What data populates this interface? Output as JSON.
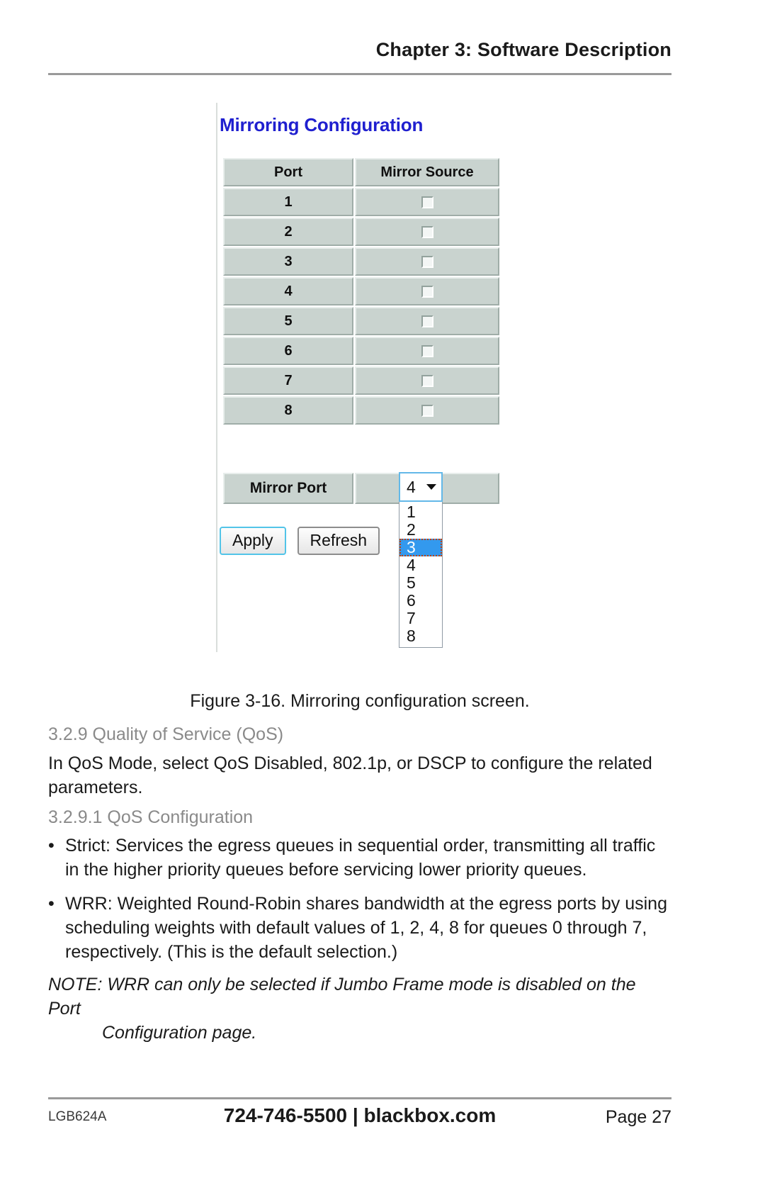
{
  "header": {
    "chapter_title": "Chapter 3: Software Description"
  },
  "figure": {
    "screen_title": "Mirroring Configuration",
    "title_color": "#1f1fcf",
    "table": {
      "columns": [
        "Port",
        "Mirror Source"
      ],
      "rows": [
        {
          "port": "1",
          "mirror_source_checked": false
        },
        {
          "port": "2",
          "mirror_source_checked": false
        },
        {
          "port": "3",
          "mirror_source_checked": false
        },
        {
          "port": "4",
          "mirror_source_checked": false
        },
        {
          "port": "5",
          "mirror_source_checked": false
        },
        {
          "port": "6",
          "mirror_source_checked": false
        },
        {
          "port": "7",
          "mirror_source_checked": false
        },
        {
          "port": "8",
          "mirror_source_checked": false
        }
      ]
    },
    "mirror_port": {
      "label": "Mirror Port",
      "selected_value": "4",
      "dropdown_open": true,
      "options": [
        "1",
        "2",
        "3",
        "4",
        "5",
        "6",
        "7",
        "8"
      ],
      "highlighted_option": "3",
      "highlight_color": "#3399ee"
    },
    "buttons": {
      "apply": "Apply",
      "refresh": "Refresh",
      "apply_focus_color": "#52c4e8"
    },
    "caption": "Figure 3-16. Mirroring configuration screen."
  },
  "content": {
    "section_qos_heading": "3.2.9 Quality of Service (QoS)",
    "section_qos_body": "In QoS Mode, select QoS Disabled, 802.1p, or DSCP to configure the related parameters.",
    "section_qos_config_heading": "3.2.9.1 QoS Configuration",
    "bullet_marker": "•",
    "bullet_strict": "Strict: Services the egress queues in sequential order, transmitting all traffic in the higher priority queues before servicing lower priority queues.",
    "bullet_wrr": "WRR: Weighted Round-Robin shares bandwidth at the egress ports by using scheduling weights with default values of 1, 2, 4, 8 for queues 0 through 7, respectively. (This is the default selection.)",
    "note_line1": "NOTE: WRR can only be selected if Jumbo Frame mode is disabled on the Port",
    "note_line2": "Configuration page."
  },
  "footer": {
    "model": "LGB624A",
    "contact": "724-746-5500  |  blackbox.com",
    "page": "Page 27"
  }
}
